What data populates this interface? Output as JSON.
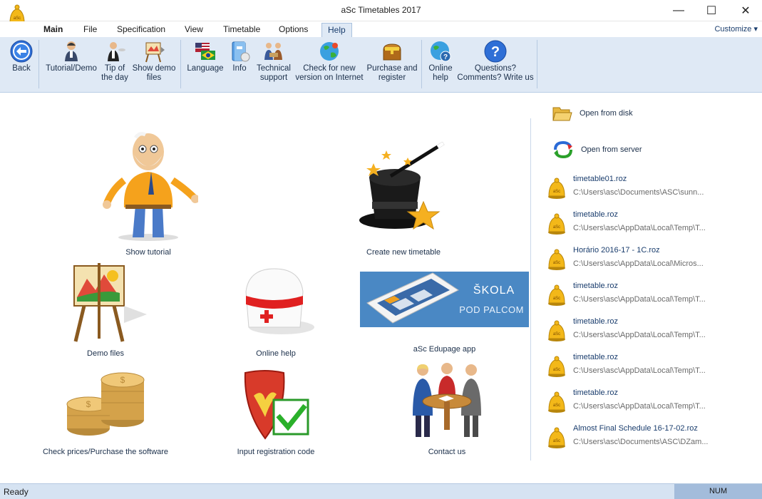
{
  "window": {
    "title": "aSc Timetables 2017",
    "minimize": "—",
    "maximize": "☐",
    "close": "✕"
  },
  "menu": {
    "tabs": [
      "Main",
      "File",
      "Specification",
      "View",
      "Timetable",
      "Options",
      "Help"
    ],
    "active": "Help",
    "customize": "Customize ▾"
  },
  "ribbon": {
    "back": "Back",
    "tutorial": "Tutorial/Demo",
    "tip_line1": "Tip of",
    "tip_line2": "the day",
    "demo_line1": "Show demo",
    "demo_line2": "files",
    "language": "Language",
    "info": "Info",
    "support_line1": "Technical",
    "support_line2": "support",
    "check_line1": "Check for new",
    "check_line2": "version on Internet",
    "purchase_line1": "Purchase and",
    "purchase_line2": "register",
    "online_line1": "Online",
    "online_line2": "help",
    "questions_line1": "Questions?",
    "questions_line2": "Comments? Write us"
  },
  "tiles": {
    "show_tutorial": "Show tutorial",
    "create_timetable": "Create new timetable",
    "demo_files": "Demo files",
    "online_help": "Online help",
    "edupage_app": "aSc Edupage app",
    "edupage_banner_line1": "ŠKOLA",
    "edupage_banner_line2": "POD PALCOM",
    "check_prices": "Check prices/Purchase the software",
    "registration_code": "Input registration code",
    "contact_us": "Contact us"
  },
  "right_panel": {
    "open_disk": "Open from disk",
    "open_server": "Open from server",
    "recent": [
      {
        "name": "timetable01.roz",
        "path": "C:\\Users\\asc\\Documents\\ASC\\sunn..."
      },
      {
        "name": "timetable.roz",
        "path": "C:\\Users\\asc\\AppData\\Local\\Temp\\T..."
      },
      {
        "name": "Horário 2016-17 - 1C.roz",
        "path": "C:\\Users\\asc\\AppData\\Local\\Micros..."
      },
      {
        "name": "timetable.roz",
        "path": "C:\\Users\\asc\\AppData\\Local\\Temp\\T..."
      },
      {
        "name": "timetable.roz",
        "path": "C:\\Users\\asc\\AppData\\Local\\Temp\\T..."
      },
      {
        "name": "timetable.roz",
        "path": "C:\\Users\\asc\\AppData\\Local\\Temp\\T..."
      },
      {
        "name": "timetable.roz",
        "path": "C:\\Users\\asc\\AppData\\Local\\Temp\\T..."
      },
      {
        "name": "Almost Final Schedule 16-17-02.roz",
        "path": "C:\\Users\\asc\\Documents\\ASC\\DZam..."
      }
    ]
  },
  "status": {
    "ready": "Ready",
    "num": "NUM"
  },
  "colors": {
    "ribbon_bg": "#dfe9f5",
    "accent": "#1a3d6d",
    "status_bg": "#d6e3f2"
  }
}
